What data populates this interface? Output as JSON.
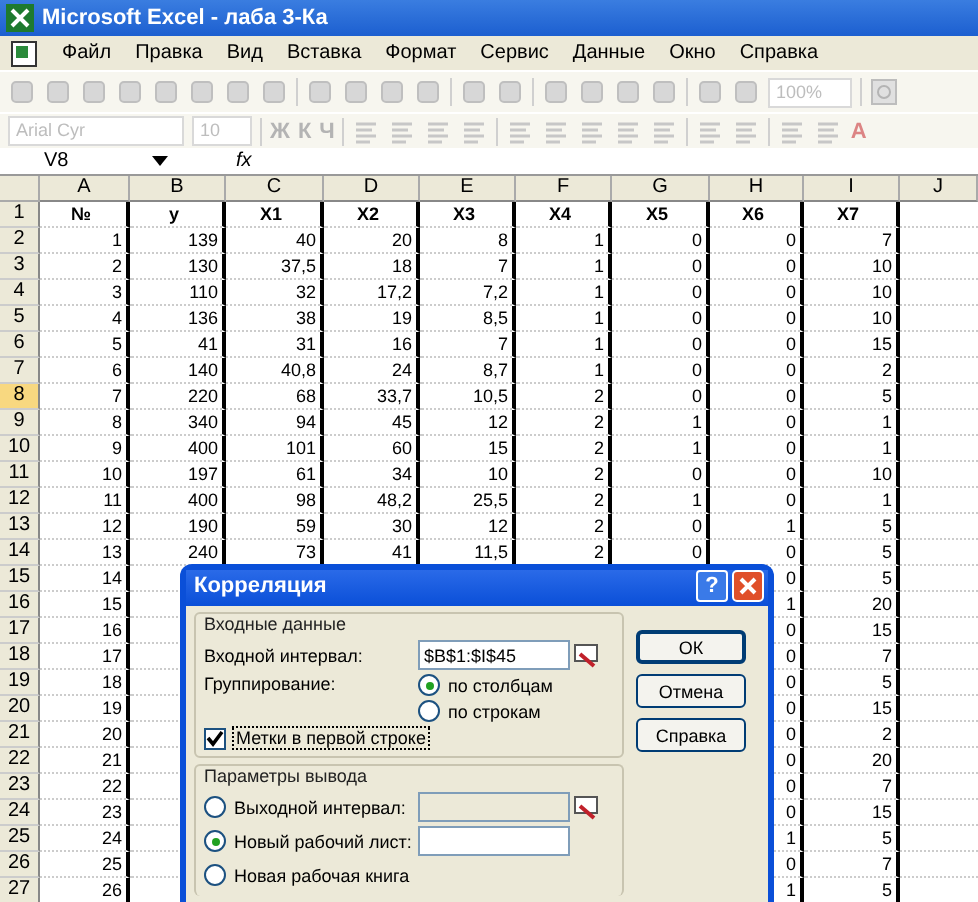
{
  "window": {
    "title": "Microsoft Excel - лаба 3-Ка"
  },
  "menu": [
    "Файл",
    "Правка",
    "Вид",
    "Вставка",
    "Формат",
    "Сервис",
    "Данные",
    "Окно",
    "Справка"
  ],
  "toolbars": {
    "disabled": true,
    "zoom": "100%",
    "font": "Arial Cyr",
    "font_size": "10",
    "format_buttons": [
      "Ж",
      "К",
      "Ч"
    ],
    "font_color_button": "A"
  },
  "formula_bar": {
    "name_box": "V8",
    "fx": "fx"
  },
  "columns": [
    "A",
    "B",
    "C",
    "D",
    "E",
    "F",
    "G",
    "H",
    "I",
    "J"
  ],
  "header_row": {
    "number": "1",
    "selected": false,
    "cells": [
      "№",
      "у",
      "X1",
      "X2",
      "X3",
      "X4",
      "X5",
      "X6",
      "X7"
    ]
  },
  "rows": [
    {
      "number": "2",
      "selected": false,
      "cells": [
        "1",
        "139",
        "40",
        "20",
        "8",
        "1",
        "0",
        "0",
        "7"
      ]
    },
    {
      "number": "3",
      "selected": false,
      "cells": [
        "2",
        "130",
        "37,5",
        "18",
        "7",
        "1",
        "0",
        "0",
        "10"
      ]
    },
    {
      "number": "4",
      "selected": false,
      "cells": [
        "3",
        "110",
        "32",
        "17,2",
        "7,2",
        "1",
        "0",
        "0",
        "10"
      ]
    },
    {
      "number": "5",
      "selected": false,
      "cells": [
        "4",
        "136",
        "38",
        "19",
        "8,5",
        "1",
        "0",
        "0",
        "10"
      ]
    },
    {
      "number": "6",
      "selected": false,
      "cells": [
        "5",
        "41",
        "31",
        "16",
        "7",
        "1",
        "0",
        "0",
        "15"
      ]
    },
    {
      "number": "7",
      "selected": false,
      "cells": [
        "6",
        "140",
        "40,8",
        "24",
        "8,7",
        "1",
        "0",
        "0",
        "2"
      ]
    },
    {
      "number": "8",
      "selected": true,
      "cells": [
        "7",
        "220",
        "68",
        "33,7",
        "10,5",
        "2",
        "0",
        "0",
        "5"
      ]
    },
    {
      "number": "9",
      "selected": false,
      "cells": [
        "8",
        "340",
        "94",
        "45",
        "12",
        "2",
        "1",
        "0",
        "1"
      ]
    },
    {
      "number": "10",
      "selected": false,
      "cells": [
        "9",
        "400",
        "101",
        "60",
        "15",
        "2",
        "1",
        "0",
        "1"
      ]
    },
    {
      "number": "11",
      "selected": false,
      "cells": [
        "10",
        "197",
        "61",
        "34",
        "10",
        "2",
        "0",
        "0",
        "10"
      ]
    },
    {
      "number": "12",
      "selected": false,
      "cells": [
        "11",
        "400",
        "98",
        "48,2",
        "25,5",
        "2",
        "1",
        "0",
        "1"
      ]
    },
    {
      "number": "13",
      "selected": false,
      "cells": [
        "12",
        "190",
        "59",
        "30",
        "12",
        "2",
        "0",
        "1",
        "5"
      ]
    },
    {
      "number": "14",
      "selected": false,
      "cells": [
        "13",
        "240",
        "73",
        "41",
        "11,5",
        "2",
        "0",
        "0",
        "5"
      ]
    },
    {
      "number": "15",
      "selected": false,
      "cells": [
        "14",
        null,
        null,
        null,
        null,
        null,
        null,
        "0",
        "5"
      ]
    },
    {
      "number": "16",
      "selected": false,
      "cells": [
        "15",
        null,
        null,
        null,
        null,
        null,
        null,
        "1",
        "20"
      ]
    },
    {
      "number": "17",
      "selected": false,
      "cells": [
        "16",
        null,
        null,
        null,
        null,
        null,
        null,
        "0",
        "15"
      ]
    },
    {
      "number": "18",
      "selected": false,
      "cells": [
        "17",
        null,
        null,
        null,
        null,
        null,
        null,
        "0",
        "7"
      ]
    },
    {
      "number": "19",
      "selected": false,
      "cells": [
        "18",
        null,
        null,
        null,
        null,
        null,
        null,
        "0",
        "5"
      ]
    },
    {
      "number": "20",
      "selected": false,
      "cells": [
        "19",
        null,
        null,
        null,
        null,
        null,
        null,
        "0",
        "15"
      ]
    },
    {
      "number": "21",
      "selected": false,
      "cells": [
        "20",
        null,
        null,
        null,
        null,
        null,
        null,
        "0",
        "2"
      ]
    },
    {
      "number": "22",
      "selected": false,
      "cells": [
        "21",
        null,
        null,
        null,
        null,
        null,
        null,
        "0",
        "20"
      ]
    },
    {
      "number": "23",
      "selected": false,
      "cells": [
        "22",
        null,
        null,
        null,
        null,
        null,
        null,
        "0",
        "7"
      ]
    },
    {
      "number": "24",
      "selected": false,
      "cells": [
        "23",
        null,
        null,
        null,
        null,
        null,
        null,
        "0",
        "15"
      ]
    },
    {
      "number": "25",
      "selected": false,
      "cells": [
        "24",
        null,
        null,
        null,
        null,
        null,
        null,
        "1",
        "5"
      ]
    },
    {
      "number": "26",
      "selected": false,
      "cells": [
        "25",
        null,
        null,
        null,
        null,
        null,
        null,
        "0",
        "7"
      ]
    },
    {
      "number": "27",
      "selected": false,
      "cells": [
        "26",
        null,
        null,
        null,
        null,
        null,
        null,
        "1",
        "5"
      ]
    }
  ],
  "dialog": {
    "title": "Корреляция",
    "help_button": "?",
    "input_group": {
      "legend": "Входные данные",
      "range_label": "Входной интервал:",
      "range_value": "$B$1:$I$45",
      "grouping_label": "Группирование:",
      "grouping": [
        {
          "label": "по столбцам",
          "selected": true
        },
        {
          "label": "по строкам",
          "selected": false
        }
      ],
      "labels_checkbox": {
        "label": "Метки в первой строке",
        "checked": true
      }
    },
    "output_group": {
      "legend": "Параметры вывода",
      "options": [
        {
          "label": "Выходной интервал:",
          "selected": false,
          "kind": "rangefield"
        },
        {
          "label": "Новый рабочий лист:",
          "selected": true,
          "kind": "textfield"
        },
        {
          "label": "Новая рабочая книга",
          "selected": false,
          "kind": "plain"
        }
      ]
    },
    "buttons": [
      "ОК",
      "Отмена",
      "Справка"
    ]
  }
}
